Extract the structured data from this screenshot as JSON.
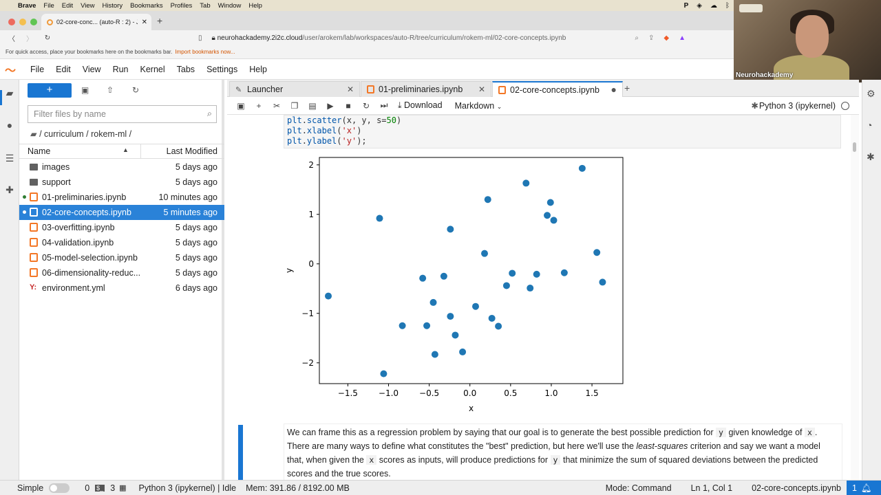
{
  "os_menubar": {
    "items": [
      "Brave",
      "File",
      "Edit",
      "View",
      "History",
      "Bookmarks",
      "Profiles",
      "Tab",
      "Window",
      "Help"
    ]
  },
  "browser": {
    "tab_title": "02-core-conc... (auto-R : 2) - J",
    "url_host": "neurohackademy.2i2c.cloud",
    "url_path": "/user/arokem/lab/workspaces/auto-R/tree/curriculum/rokem-ml/02-core-concepts.ipynb",
    "bookmarks_hint": "For quick access, place your bookmarks here on the bookmarks bar.",
    "bookmarks_link": "Import bookmarks now..."
  },
  "video": {
    "name": "Neurohackademy"
  },
  "jupyter_menu": [
    "File",
    "Edit",
    "View",
    "Run",
    "Kernel",
    "Tabs",
    "Settings",
    "Help"
  ],
  "file_browser": {
    "new_label": "+",
    "filter_placeholder": "Filter files by name",
    "breadcrumb": "/ curriculum / rokem-ml /",
    "col_name": "Name",
    "col_modified": "Last Modified",
    "files": [
      {
        "name": "images",
        "modified": "5 days ago",
        "type": "folder",
        "running": false,
        "selected": false
      },
      {
        "name": "support",
        "modified": "5 days ago",
        "type": "folder",
        "running": false,
        "selected": false
      },
      {
        "name": "01-preliminaries.ipynb",
        "modified": "10 minutes ago",
        "type": "notebook",
        "running": true,
        "selected": false
      },
      {
        "name": "02-core-concepts.ipynb",
        "modified": "5 minutes ago",
        "type": "notebook",
        "running": true,
        "selected": true
      },
      {
        "name": "03-overfitting.ipynb",
        "modified": "5 days ago",
        "type": "notebook",
        "running": false,
        "selected": false
      },
      {
        "name": "04-validation.ipynb",
        "modified": "5 days ago",
        "type": "notebook",
        "running": false,
        "selected": false
      },
      {
        "name": "05-model-selection.ipynb",
        "modified": "5 days ago",
        "type": "notebook",
        "running": false,
        "selected": false
      },
      {
        "name": "06-dimensionality-reduc...",
        "modified": "5 days ago",
        "type": "notebook",
        "running": false,
        "selected": false
      },
      {
        "name": "environment.yml",
        "modified": "6 days ago",
        "type": "yaml",
        "running": false,
        "selected": false
      }
    ]
  },
  "notebook_tabs": [
    {
      "label": "Launcher",
      "current": false
    },
    {
      "label": "01-preliminaries.ipynb",
      "current": false
    },
    {
      "label": "02-core-concepts.ipynb",
      "current": true
    }
  ],
  "toolbar": {
    "download": "Download",
    "cell_type": "Markdown",
    "kernel": "Python 3 (ipykernel)"
  },
  "code_lines": [
    "plt.scatter(x, y, s=50)",
    "plt.xlabel('x')",
    "plt.ylabel('y');"
  ],
  "chart_data": {
    "type": "scatter",
    "xlabel": "x",
    "ylabel": "y",
    "xlim": [
      -1.85,
      1.88
    ],
    "ylim": [
      -2.42,
      2.15
    ],
    "xticks": [
      -1.5,
      -1.0,
      -0.5,
      0.0,
      0.5,
      1.0,
      1.5
    ],
    "xtick_labels": [
      "−1.5",
      "−1.0",
      "−0.5",
      "0.0",
      "0.5",
      "1.0",
      "1.5"
    ],
    "yticks": [
      -2,
      -1,
      0,
      1,
      2
    ],
    "ytick_labels": [
      "−2",
      "−1",
      "0",
      "1",
      "2"
    ],
    "color": "#1f77b4",
    "points": [
      [
        -1.74,
        -0.65
      ],
      [
        -1.11,
        0.92
      ],
      [
        -1.06,
        -2.22
      ],
      [
        -0.83,
        -1.25
      ],
      [
        -0.58,
        -0.29
      ],
      [
        -0.53,
        -1.25
      ],
      [
        -0.45,
        -0.78
      ],
      [
        -0.43,
        -1.83
      ],
      [
        -0.32,
        -0.25
      ],
      [
        -0.24,
        0.7
      ],
      [
        -0.24,
        -1.06
      ],
      [
        -0.18,
        -1.44
      ],
      [
        -0.09,
        -1.78
      ],
      [
        0.07,
        -0.86
      ],
      [
        0.18,
        0.21
      ],
      [
        0.22,
        1.3
      ],
      [
        0.27,
        -1.1
      ],
      [
        0.35,
        -1.26
      ],
      [
        0.45,
        -0.44
      ],
      [
        0.52,
        -0.19
      ],
      [
        0.69,
        1.63
      ],
      [
        0.74,
        -0.49
      ],
      [
        0.82,
        -0.21
      ],
      [
        0.95,
        0.98
      ],
      [
        0.99,
        1.24
      ],
      [
        1.03,
        0.88
      ],
      [
        1.16,
        -0.18
      ],
      [
        1.38,
        1.93
      ],
      [
        1.56,
        0.23
      ],
      [
        1.63,
        -0.37
      ]
    ],
    "grid": false
  },
  "markdown": {
    "p1a": "We can frame this as a regression problem by saying that our goal is to generate the best possible prediction for",
    "c_y": "y",
    "p1b": "given knowledge of",
    "c_x": "x",
    "p2a": ". There are many ways to define what constitutes the \"best\" prediction, but here we'll use the",
    "em": "least-squares",
    "p2b": "criterion and say we want a model that, when given the",
    "p3a": "scores as inputs, will produce predictions for",
    "p3b": "that minimize the sum of squared deviations between the predicted scores and the true scores."
  },
  "status": {
    "simple": "Simple",
    "zero": "0",
    "three": "3",
    "kernel": "Python 3 (ipykernel) | Idle",
    "mem": "Mem: 391.86 / 8192.00 MB",
    "mode": "Mode: Command",
    "pos": "Ln 1, Col 1",
    "file": "02-core-concepts.ipynb",
    "notif": "1"
  }
}
